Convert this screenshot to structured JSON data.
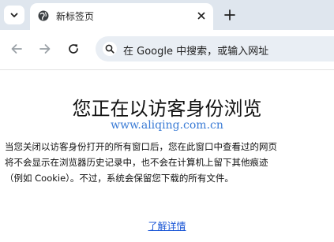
{
  "tab": {
    "title": "新标签页"
  },
  "omnibox": {
    "placeholder": "在 Google 中搜索，或输入网址"
  },
  "content": {
    "heading": "您正在以访客身份浏览",
    "watermark": "www.aliqing.com.cn",
    "description_lines": [
      "当您关闭以访客身份打开的所有窗口后，您在此窗口中查看过的网页",
      "将不会显示在浏览器历史记录中，也不会在计算机上留下其他痕迹",
      "（例如 Cookie）。不过，系统会保留您下载的所有文件。"
    ],
    "learn_more": "了解详情"
  },
  "icons": {
    "tab_search": "chevron-down-icon",
    "favicon": "globe-icon",
    "tab_close": "close-icon",
    "new_tab": "plus-icon",
    "back": "arrow-left-icon",
    "forward": "arrow-right-icon",
    "reload": "reload-icon",
    "omnibox": "search-icon"
  },
  "colors": {
    "tabstrip_bg": "#dfe6ee",
    "omnibox_bg": "#e9eef4",
    "link": "#1a56d6",
    "watermark": "#3a7bd5"
  }
}
